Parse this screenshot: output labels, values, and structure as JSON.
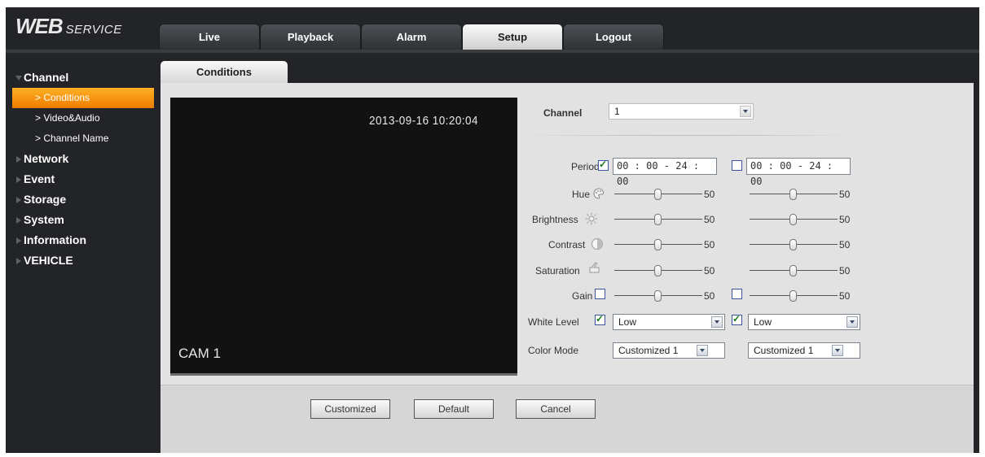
{
  "header": {
    "logo_main": "WEB",
    "logo_sub": "SERVICE",
    "tabs": [
      {
        "label": "Live"
      },
      {
        "label": "Playback"
      },
      {
        "label": "Alarm"
      },
      {
        "label": "Setup",
        "active": true
      },
      {
        "label": "Logout"
      }
    ]
  },
  "sidebar": {
    "channel": {
      "label": "Channel",
      "items": [
        {
          "label": "> Conditions",
          "active": true
        },
        {
          "label": "> Video&Audio"
        },
        {
          "label": "> Channel Name"
        }
      ]
    },
    "sections": [
      {
        "label": "Network"
      },
      {
        "label": "Event"
      },
      {
        "label": "Storage"
      },
      {
        "label": "System"
      },
      {
        "label": "Information"
      },
      {
        "label": "VEHICLE"
      }
    ]
  },
  "main": {
    "tab_label": "Conditions",
    "video": {
      "timestamp": "2013-09-16 10:20:04",
      "camera_name": "CAM 1"
    },
    "channel": {
      "label": "Channel",
      "value": "1"
    },
    "period": {
      "label": "Period",
      "period1": {
        "checked": true,
        "value": "00 : 00 - 24 : 00"
      },
      "period2": {
        "checked": false,
        "value": "00 : 00 - 24 : 00"
      }
    },
    "sliders": [
      {
        "label": "Hue",
        "icon": "hue-icon",
        "p1": 50,
        "p2": 50
      },
      {
        "label": "Brightness",
        "icon": "brightness-icon",
        "p1": 50,
        "p2": 50
      },
      {
        "label": "Contrast",
        "icon": "contrast-icon",
        "p1": 50,
        "p2": 50
      },
      {
        "label": "Saturation",
        "icon": "saturation-icon",
        "p1": 50,
        "p2": 50
      },
      {
        "label": "Gain",
        "icon": "checkbox",
        "p1": 50,
        "p2": 50,
        "p1_checked": false,
        "p2_checked": false
      }
    ],
    "white_level": {
      "label": "White Level",
      "p1_checked": true,
      "p1_value": "Low",
      "p2_checked": true,
      "p2_value": "Low"
    },
    "color_mode": {
      "label": "Color Mode",
      "p1_value": "Customized 1",
      "p2_value": "Customized 1"
    },
    "buttons": {
      "customized": "Customized",
      "default": "Default",
      "cancel": "Cancel"
    }
  },
  "colors": {
    "background": "#222427",
    "accent_orange": "#f39100",
    "panel": "#e2e2e2",
    "check": "#157a1d"
  }
}
